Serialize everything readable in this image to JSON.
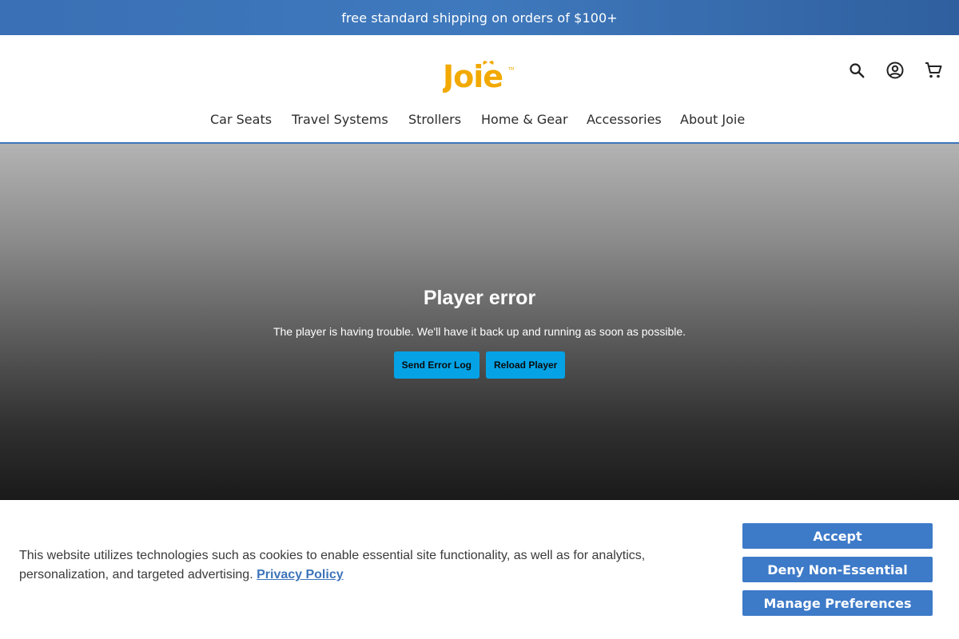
{
  "promo": {
    "text": "free standard shipping on orders of $100+"
  },
  "brand": {
    "logo_text": "Joie",
    "trademark": "TM",
    "logo_color": "#f2a900"
  },
  "header": {
    "icons": [
      {
        "name": "search-icon"
      },
      {
        "name": "account-icon"
      },
      {
        "name": "cart-icon"
      }
    ]
  },
  "nav": {
    "items": [
      {
        "label": "Car Seats"
      },
      {
        "label": "Travel Systems"
      },
      {
        "label": "Strollers"
      },
      {
        "label": "Home & Gear"
      },
      {
        "label": "Accessories"
      },
      {
        "label": "About Joie"
      }
    ]
  },
  "player": {
    "error_title": "Player error",
    "error_message": "The player is having trouble. We'll have it back up and running as soon as possible.",
    "send_log_label": "Send Error Log",
    "reload_label": "Reload Player"
  },
  "cookie": {
    "text": "This website utilizes technologies such as cookies to enable essential site functionality, as well as for analytics, personalization, and targeted advertising.",
    "privacy_link": "Privacy Policy",
    "accept_label": "Accept",
    "deny_label": "Deny Non-Essential",
    "manage_label": "Manage Preferences"
  },
  "colors": {
    "accent_blue": "#3d74b9",
    "player_button": "#05a3e6",
    "brand_yellow": "#f2a900"
  }
}
